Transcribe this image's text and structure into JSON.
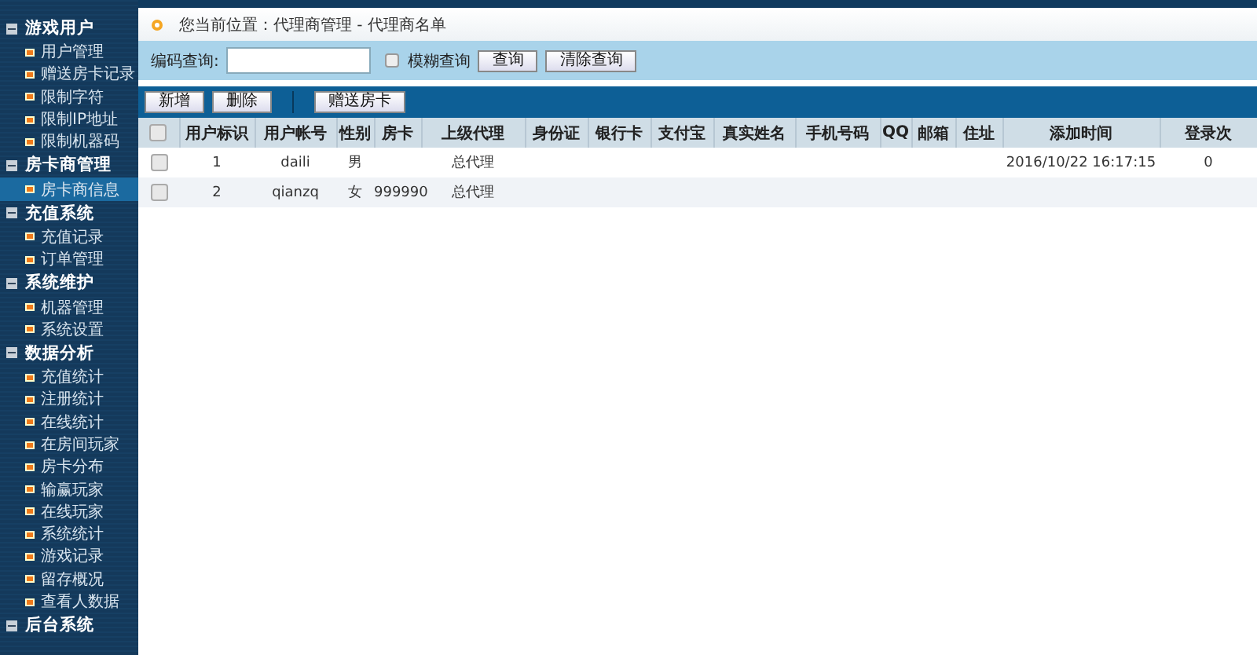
{
  "sidebar": {
    "groups": [
      {
        "label": "游戏用户",
        "expanded": true,
        "items": [
          {
            "label": "用户管理",
            "selected": false
          },
          {
            "label": "赠送房卡记录",
            "selected": false
          },
          {
            "label": "限制字符",
            "selected": false
          },
          {
            "label": "限制IP地址",
            "selected": false
          },
          {
            "label": "限制机器码",
            "selected": false
          }
        ]
      },
      {
        "label": "房卡商管理",
        "expanded": true,
        "items": [
          {
            "label": "房卡商信息",
            "selected": true
          }
        ]
      },
      {
        "label": "充值系统",
        "expanded": true,
        "items": [
          {
            "label": "充值记录",
            "selected": false
          },
          {
            "label": "订单管理",
            "selected": false
          }
        ]
      },
      {
        "label": "系统维护",
        "expanded": true,
        "items": [
          {
            "label": "机器管理",
            "selected": false
          },
          {
            "label": "系统设置",
            "selected": false
          }
        ]
      },
      {
        "label": "数据分析",
        "expanded": true,
        "items": [
          {
            "label": "充值统计",
            "selected": false
          },
          {
            "label": "注册统计",
            "selected": false
          },
          {
            "label": "在线统计",
            "selected": false
          },
          {
            "label": "在房间玩家",
            "selected": false
          },
          {
            "label": "房卡分布",
            "selected": false
          },
          {
            "label": "输赢玩家",
            "selected": false
          },
          {
            "label": "在线玩家",
            "selected": false
          },
          {
            "label": "系统统计",
            "selected": false
          },
          {
            "label": "游戏记录",
            "selected": false
          },
          {
            "label": "留存概况",
            "selected": false
          },
          {
            "label": "查看人数据",
            "selected": false
          }
        ]
      },
      {
        "label": "后台系统",
        "expanded": true
      }
    ]
  },
  "breadcrumb": "您当前位置：代理商管理 - 代理商名单",
  "search": {
    "label": "编码查询:",
    "fuzzy": {
      "label": "模糊查询",
      "checked": false
    },
    "buttons": [
      "查询",
      "清除查询"
    ]
  },
  "toolbar": {
    "groups": [
      [
        "新增",
        "删除"
      ],
      [
        "赠送房卡"
      ]
    ]
  },
  "table": {
    "all_checked": false,
    "columns": [
      "用户标识",
      "用户帐号",
      "性别",
      "房卡",
      "上级代理",
      "身份证",
      "银行卡",
      "支付宝",
      "真实姓名",
      "手机号码",
      "QQ",
      "邮箱",
      "住址",
      "添加时间",
      "登录次"
    ],
    "rows": [
      {
        "checked": false,
        "cells": [
          "1",
          "daili",
          "男",
          "",
          "总代理",
          "",
          "",
          "",
          "",
          "",
          "",
          "",
          "",
          "2016/10/22 16:17:15",
          "0"
        ]
      },
      {
        "checked": false,
        "cells": [
          "2",
          "qianzq",
          "女",
          "999990",
          "总代理",
          "",
          "",
          "",
          "",
          "",
          "",
          "",
          "",
          "",
          ""
        ]
      }
    ]
  }
}
